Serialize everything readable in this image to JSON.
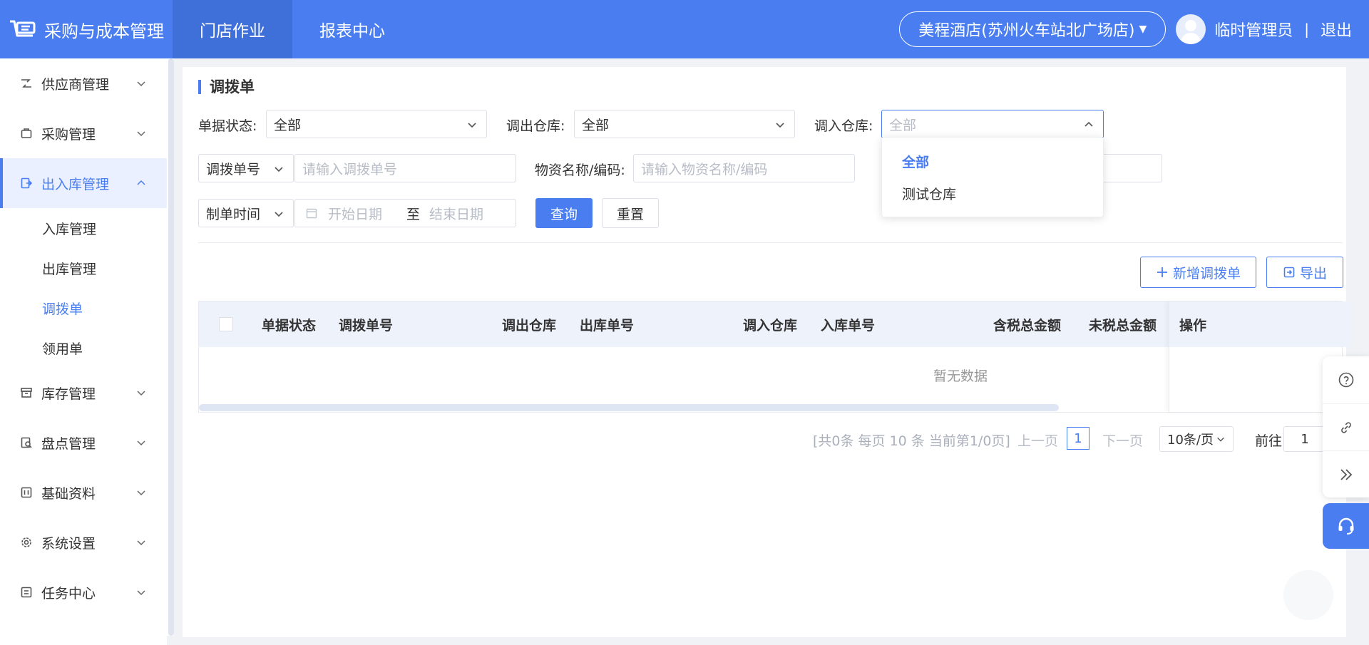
{
  "header": {
    "brand_title": "采购与成本管理",
    "tabs": [
      {
        "label": "门店作业",
        "active": true
      },
      {
        "label": "报表中心",
        "active": false
      }
    ],
    "store_name": "美程酒店(苏州火车站北广场店)",
    "user_name": "临时管理员",
    "separator": "|",
    "logout_label": "退出"
  },
  "sidebar": {
    "items": [
      {
        "label": "供应商管理",
        "icon": "supplier-icon",
        "expanded": false
      },
      {
        "label": "采购管理",
        "icon": "purchase-icon",
        "expanded": false
      },
      {
        "label": "出入库管理",
        "icon": "inout-icon",
        "expanded": true,
        "active": true
      },
      {
        "label": "库存管理",
        "icon": "inventory-icon",
        "expanded": false
      },
      {
        "label": "盘点管理",
        "icon": "stocktake-icon",
        "expanded": false
      },
      {
        "label": "基础资料",
        "icon": "basic-data-icon",
        "expanded": false
      },
      {
        "label": "系统设置",
        "icon": "gear-icon",
        "expanded": false
      },
      {
        "label": "任务中心",
        "icon": "task-icon",
        "expanded": false
      }
    ],
    "sub_items": [
      {
        "label": "入库管理",
        "active": false
      },
      {
        "label": "出库管理",
        "active": false
      },
      {
        "label": "调拨单",
        "active": true
      },
      {
        "label": "领用单",
        "active": false
      }
    ]
  },
  "page": {
    "title": "调拨单"
  },
  "filters": {
    "status_label": "单据状态:",
    "status_value": "全部",
    "out_wh_label": "调出仓库:",
    "out_wh_value": "全部",
    "in_wh_label": "调入仓库:",
    "in_wh_placeholder": "全部",
    "doc_type_value": "调拨单号",
    "doc_no_placeholder": "请输入调拨单号",
    "material_label": "物资名称/编码:",
    "material_placeholder": "请输入物资名称/编码",
    "date_type_value": "制单时间",
    "start_date_placeholder": "开始日期",
    "date_to": "至",
    "end_date_placeholder": "结束日期",
    "query_label": "查询",
    "reset_label": "重置"
  },
  "dropdown": {
    "options": [
      {
        "label": "全部",
        "selected": true
      },
      {
        "label": "测试仓库",
        "selected": false
      }
    ]
  },
  "toolbar": {
    "add_label": "新增调拨单",
    "export_label": "导出"
  },
  "table": {
    "columns": [
      "单据状态",
      "调拨单号",
      "调出仓库",
      "出库单号",
      "调入仓库",
      "入库单号",
      "含税总金额",
      "未税总金额",
      "操作"
    ],
    "empty_text": "暂无数据"
  },
  "pagination": {
    "summary": "[共0条 每页 10 条 当前第1/0页]",
    "prev_label": "上一页",
    "current_page": "1",
    "next_label": "下一页",
    "page_size": "10条/页",
    "goto_label": "前往",
    "goto_value": "1"
  },
  "colors": {
    "primary": "#4a7ef0",
    "header_active": "#3f6fd8",
    "menu_active_bg": "#eaf0ff"
  }
}
